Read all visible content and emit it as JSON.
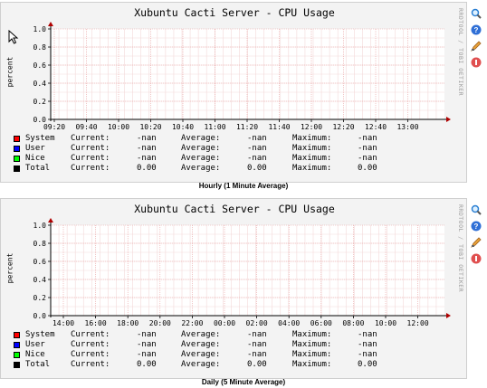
{
  "graphs": [
    {
      "title": "Xubuntu Cacti Server - CPU Usage",
      "caption": "Hourly (1 Minute Average)",
      "ylabel": "percent",
      "sidelabel": "RRDTOOL / TOBI OETIKER",
      "chart_data": {
        "type": "line",
        "title": "Xubuntu Cacti Server - CPU Usage",
        "ylabel": "percent",
        "ylim": [
          0,
          1.0
        ],
        "y_ticks": [
          "0.0",
          "0.2",
          "0.4",
          "0.6",
          "0.8",
          "1.0"
        ],
        "x_ticks": [
          "09:20",
          "09:40",
          "10:00",
          "10:20",
          "10:40",
          "11:00",
          "11:20",
          "11:40",
          "12:00",
          "12:20",
          "12:40",
          "13:00"
        ],
        "grid": true,
        "series": [
          {
            "name": "System",
            "color": "#ff0000",
            "values": []
          },
          {
            "name": "User",
            "color": "#0000ff",
            "values": []
          },
          {
            "name": "Nice",
            "color": "#00ff00",
            "values": []
          },
          {
            "name": "Total",
            "color": "#000000",
            "values": []
          }
        ]
      },
      "legend": [
        {
          "name": "System",
          "color": "#ff0000",
          "current_label": "Current:",
          "current": "-nan",
          "average_label": "Average:",
          "average": "-nan",
          "maximum_label": "Maximum:",
          "maximum": "-nan"
        },
        {
          "name": "User",
          "color": "#0000ff",
          "current_label": "Current:",
          "current": "-nan",
          "average_label": "Average:",
          "average": "-nan",
          "maximum_label": "Maximum:",
          "maximum": "-nan"
        },
        {
          "name": "Nice",
          "color": "#00ff00",
          "current_label": "Current:",
          "current": "-nan",
          "average_label": "Average:",
          "average": "-nan",
          "maximum_label": "Maximum:",
          "maximum": "-nan"
        },
        {
          "name": "Total",
          "color": "#000000",
          "current_label": "Current:",
          "current": "0.00",
          "average_label": "Average:",
          "average": "0.00",
          "maximum_label": "Maximum:",
          "maximum": "0.00"
        }
      ]
    },
    {
      "title": "Xubuntu Cacti Server - CPU Usage",
      "caption": "Daily (5 Minute Average)",
      "ylabel": "percent",
      "sidelabel": "RRDTOOL / TOBI OETIKER",
      "chart_data": {
        "type": "line",
        "title": "Xubuntu Cacti Server - CPU Usage",
        "ylabel": "percent",
        "ylim": [
          0,
          1.0
        ],
        "y_ticks": [
          "0.0",
          "0.2",
          "0.4",
          "0.6",
          "0.8",
          "1.0"
        ],
        "x_ticks": [
          "14:00",
          "16:00",
          "18:00",
          "20:00",
          "22:00",
          "00:00",
          "02:00",
          "04:00",
          "06:00",
          "08:00",
          "10:00",
          "12:00"
        ],
        "grid": true,
        "series": [
          {
            "name": "System",
            "color": "#ff0000",
            "values": []
          },
          {
            "name": "User",
            "color": "#0000ff",
            "values": []
          },
          {
            "name": "Nice",
            "color": "#00ff00",
            "values": []
          },
          {
            "name": "Total",
            "color": "#000000",
            "values": []
          }
        ]
      },
      "legend": [
        {
          "name": "System",
          "color": "#ff0000",
          "current_label": "Current:",
          "current": "-nan",
          "average_label": "Average:",
          "average": "-nan",
          "maximum_label": "Maximum:",
          "maximum": "-nan"
        },
        {
          "name": "User",
          "color": "#0000ff",
          "current_label": "Current:",
          "current": "-nan",
          "average_label": "Average:",
          "average": "-nan",
          "maximum_label": "Maximum:",
          "maximum": "-nan"
        },
        {
          "name": "Nice",
          "color": "#00ff00",
          "current_label": "Current:",
          "current": "-nan",
          "average_label": "Average:",
          "average": "-nan",
          "maximum_label": "Maximum:",
          "maximum": "-nan"
        },
        {
          "name": "Total",
          "color": "#000000",
          "current_label": "Current:",
          "current": "0.00",
          "average_label": "Average:",
          "average": "0.00",
          "maximum_label": "Maximum:",
          "maximum": "0.00"
        }
      ]
    }
  ],
  "icons": [
    "zoom-icon",
    "info-icon",
    "edit-icon",
    "remove-icon"
  ]
}
